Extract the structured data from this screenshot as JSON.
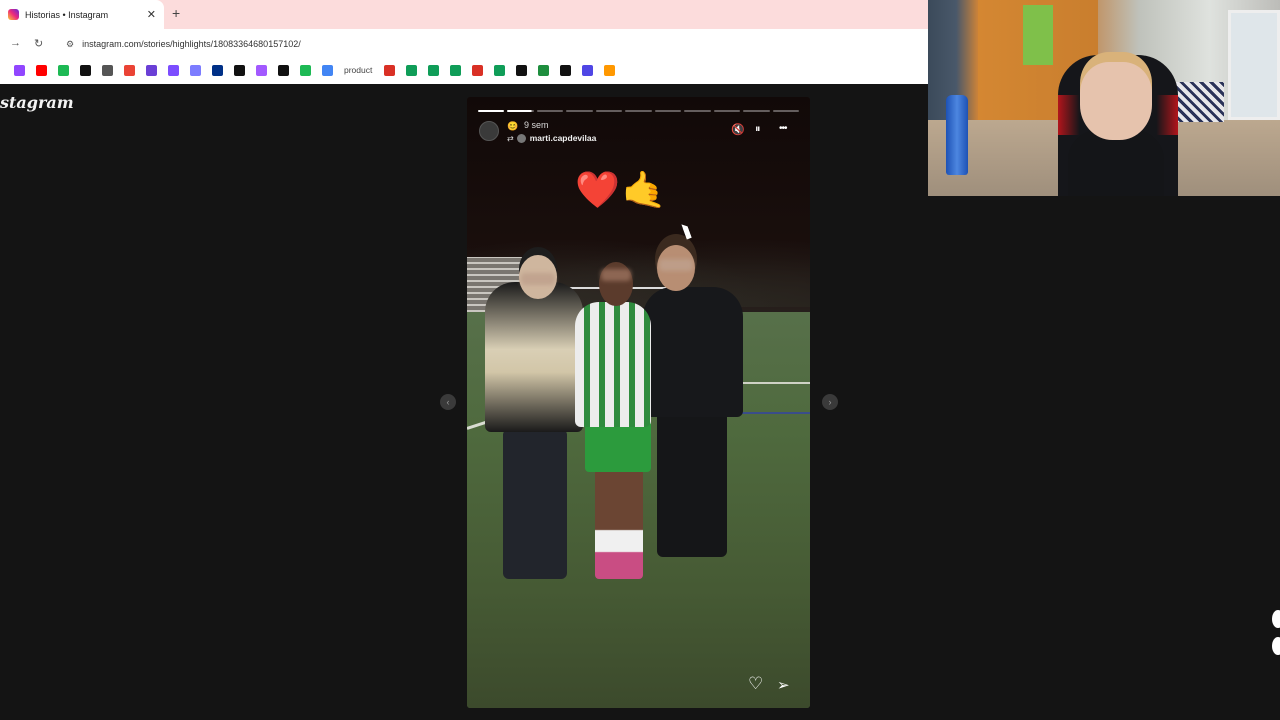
{
  "browser": {
    "tab_title": "Historias • Instagram",
    "tab_close": "✕",
    "new_tab": "+",
    "back": "→",
    "reload": "↻",
    "site_info": "⚙",
    "url": "instagram.com/stories/highlights/18083364680157102/",
    "bookmark_text": "product",
    "bookmark_colors": [
      "#9146ff",
      "#ff0000",
      "#1db954",
      "#111111",
      "#555555",
      "#ea4335",
      "#6a3fd6",
      "#7c4dff",
      "#7c7cff",
      "#003087",
      "#111111",
      "#a259ff",
      "#111111",
      "#1db954",
      "#4285f4",
      "#d93025",
      "#0f9d58",
      "#0f9d58",
      "#0f9d58",
      "#d93025",
      "#0f9d58",
      "#111111",
      "#1e8e3e",
      "#111111",
      "#4f46e5",
      "#ff9800"
    ]
  },
  "page": {
    "logo": "stagram"
  },
  "story": {
    "time": "9 sem",
    "username": "marti.capdevilaa",
    "highlight_emoji": "😊",
    "repost_icon": "⇄",
    "mute_icon": "🔇",
    "pause_icon": "⏸",
    "more_icon": "•••",
    "emojis": "❤️🤙",
    "like_icon": "♡",
    "share_icon": "➢",
    "progress_segments": 11,
    "progress_done": 1,
    "progress_active_index": 1
  },
  "nav": {
    "prev": "‹",
    "next": "›"
  }
}
